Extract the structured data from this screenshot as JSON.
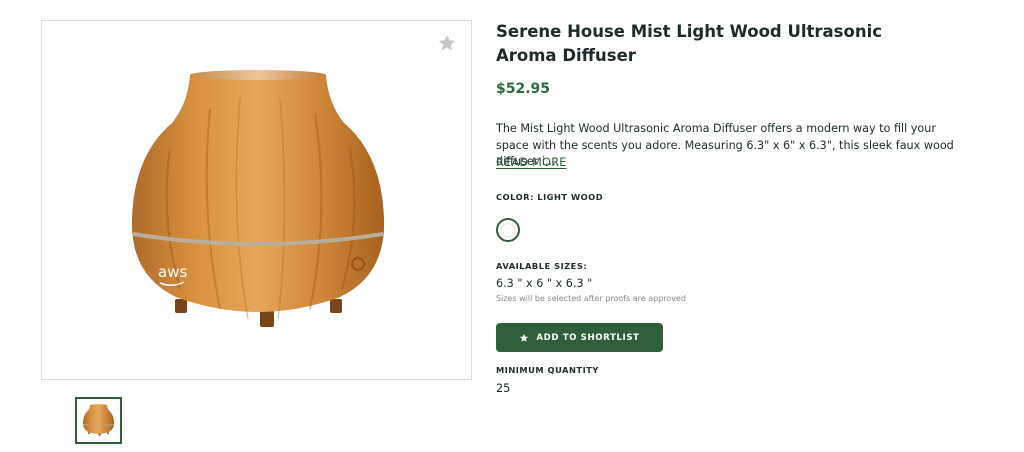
{
  "product": {
    "title": "Serene House Mist Light Wood Ultrasonic Aroma Diffuser",
    "price": "$52.95",
    "description": "The Mist Light Wood Ultrasonic Aroma Diffuser offers a modern way to fill your space with the scents you adore. Measuring 6.3\" x 6\" x 6.3\", this sleek faux wood diffuser i...",
    "read_more": "READ MORE",
    "image_logo_text": "aws"
  },
  "color": {
    "label": "COLOR: LIGHT WOOD",
    "selected_swatch": "#ffffff"
  },
  "sizes": {
    "label": "AVAILABLE SIZES:",
    "value": "6.3 \" x 6 \" x 6.3 \"",
    "note": "Sizes will be selected after proofs are approved"
  },
  "actions": {
    "shortlist_label": "ADD TO SHORTLIST"
  },
  "quantity": {
    "label": "MINIMUM QUANTITY",
    "value": "25"
  },
  "icons": {
    "favorite": "star-icon",
    "button": "star-icon"
  },
  "colors": {
    "accent": "#2e5e3a",
    "price": "#2e6a3c"
  }
}
